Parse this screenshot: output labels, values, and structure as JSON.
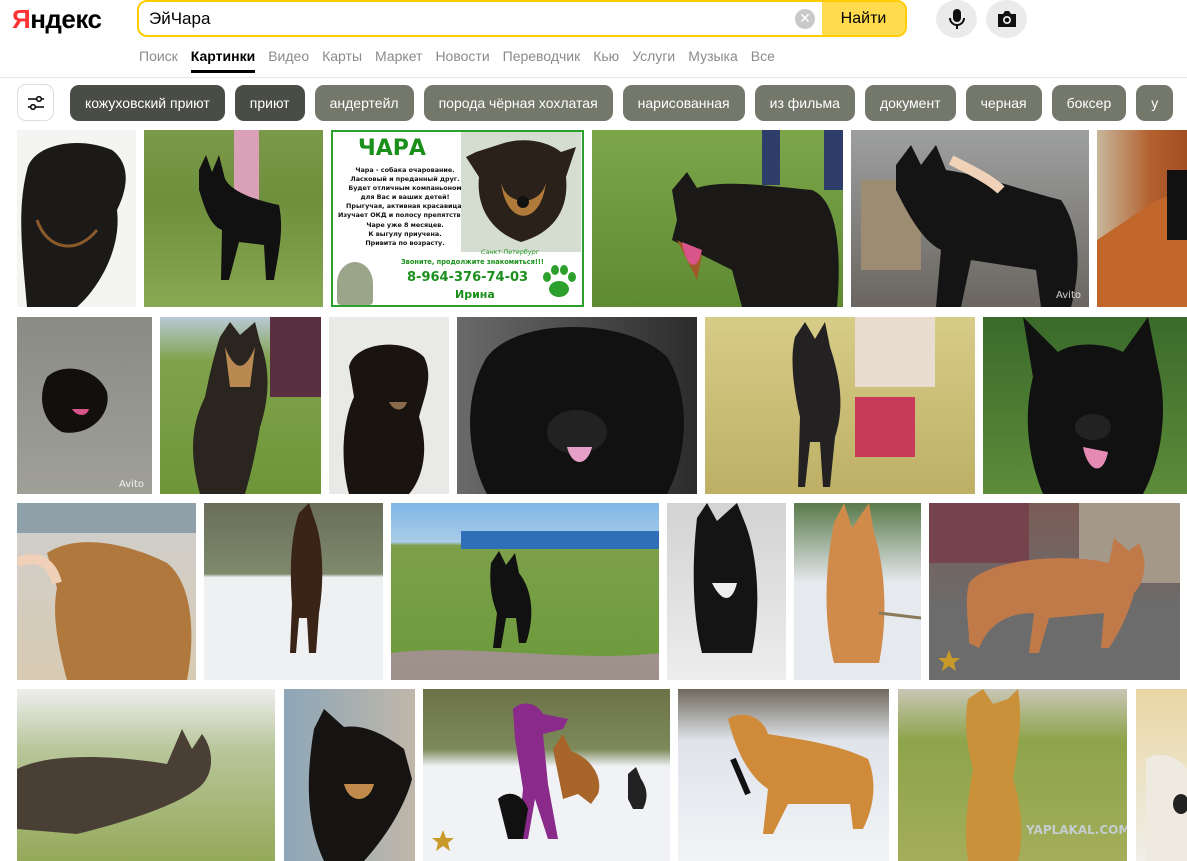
{
  "header": {
    "logo": {
      "first": "Я",
      "rest": "ндекс"
    },
    "search": {
      "value": "ЭйЧара",
      "placeholder": ""
    },
    "search_button": "Найти"
  },
  "nav": [
    {
      "label": "Поиск",
      "active": false
    },
    {
      "label": "Картинки",
      "active": true
    },
    {
      "label": "Видео",
      "active": false
    },
    {
      "label": "Карты",
      "active": false
    },
    {
      "label": "Маркет",
      "active": false
    },
    {
      "label": "Новости",
      "active": false
    },
    {
      "label": "Переводчик",
      "active": false
    },
    {
      "label": "Кью",
      "active": false
    },
    {
      "label": "Услуги",
      "active": false
    },
    {
      "label": "Музыка",
      "active": false
    },
    {
      "label": "Все",
      "active": false
    }
  ],
  "chips": [
    {
      "label": "кожуховский приют",
      "color": "#4a4d45"
    },
    {
      "label": "приют",
      "color": "#4a4d45"
    },
    {
      "label": "андертейл",
      "color": "#74786b"
    },
    {
      "label": "порода чёрная хохлатая",
      "color": "#74786b"
    },
    {
      "label": "нарисованная",
      "color": "#74786b"
    },
    {
      "label": "из фильма",
      "color": "#74786b"
    },
    {
      "label": "документ",
      "color": "#74786b"
    },
    {
      "label": "черная",
      "color": "#74786b"
    },
    {
      "label": "боксер",
      "color": "#74786b"
    },
    {
      "label": "у",
      "color": "#74786b"
    }
  ],
  "poster": {
    "title": "ЧАРА",
    "text": "Чара - собака очарование.\nЛасковый и преданный друг.\nБудет отличным компаньоном\nдля Вас и ваших детей!\nПрыгучая, активная красавица.\nИзучает ОКД и полосу препятствий.\nЧаре уже 8 месяцев.\nК выгулу приучена.\nПривита по возрасту.",
    "city": "Санкт-Петербург",
    "call": "Звоните, продолжите знакомиться!!!",
    "phone": "8-964-376-74-03",
    "name": "Ирина"
  },
  "watermarks": {
    "avito_1": "Avito",
    "avito_2": "Avito",
    "yaplakal": "YAPLAKAL.COM"
  },
  "colors": {
    "accent_yellow": "#ffdb4d",
    "search_border": "#ffcc00",
    "chip_dark": "#4a4d45",
    "chip_gray": "#74786b"
  }
}
